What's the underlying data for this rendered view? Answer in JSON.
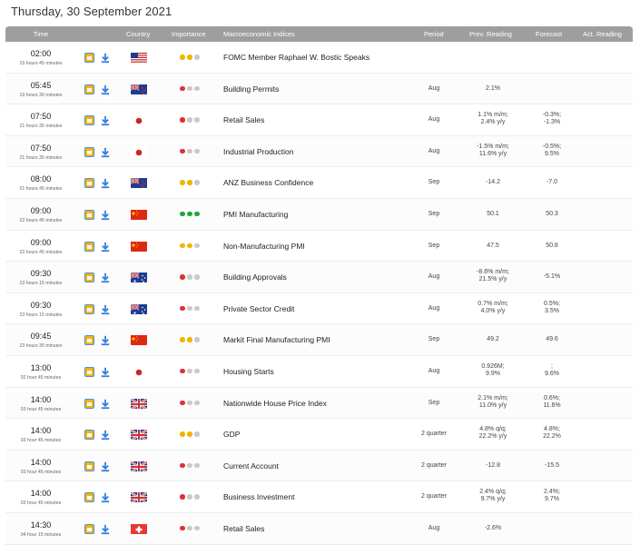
{
  "page": {
    "title": "Thursday, 30 September 2021"
  },
  "columns": {
    "time": "Time",
    "country": "Country",
    "importance": "Importance",
    "indices": "Macroeconomic Indices",
    "period": "Period",
    "prev": "Prev. Reading",
    "forecast": "Forecast",
    "actual": "Act. Reading"
  },
  "colors": {
    "header_bg": "#9e9e9e",
    "importance_high": "#22a53a",
    "importance_medium": "#f0b400",
    "importance_low": "#e03030",
    "importance_off": "#c9c9c9"
  },
  "rows": [
    {
      "time": "02:00",
      "sub": "15 hours 45 minutes",
      "flag": "us-flag",
      "importance": "medium",
      "indicator": "FOMC Member Raphael W. Bostic Speaks",
      "period": "",
      "prev": [
        "",
        ""
      ],
      "forecast": [
        "",
        ""
      ],
      "actual": ""
    },
    {
      "time": "05:45",
      "sub": "19 hours 30 minutes",
      "flag": "nz-flag",
      "importance": "low",
      "indicator": "Building Permits",
      "period": "Aug",
      "prev": [
        "2.1%",
        ""
      ],
      "forecast": [
        "",
        ""
      ],
      "actual": ""
    },
    {
      "time": "07:50",
      "sub": "21 hours 35 minutes",
      "flag": "jp-flag",
      "importance": "low",
      "indicator": "Retail Sales",
      "period": "Aug",
      "prev": [
        "1.1% m/m;",
        "2.4% y/y"
      ],
      "forecast": [
        "-0.3%;",
        "-1.3%"
      ],
      "actual": ""
    },
    {
      "time": "07:50",
      "sub": "21 hours 35 minutes",
      "flag": "jp-flag",
      "importance": "low",
      "indicator": "Industrial Production",
      "period": "Aug",
      "prev": [
        "-1.5% m/m;",
        "11.6% y/y"
      ],
      "forecast": [
        "-0.5%;",
        "9.5%"
      ],
      "actual": ""
    },
    {
      "time": "08:00",
      "sub": "21 hours 45 minutes",
      "flag": "nz-flag",
      "importance": "medium",
      "indicator": "ANZ Business Confidence",
      "period": "Sep",
      "prev": [
        "-14.2",
        ""
      ],
      "forecast": [
        "-7.0",
        ""
      ],
      "actual": ""
    },
    {
      "time": "09:00",
      "sub": "22 hours 45 minutes",
      "flag": "cn-flag",
      "importance": "high",
      "indicator": "PMI Manufacturing",
      "period": "Sep",
      "prev": [
        "50.1",
        ""
      ],
      "forecast": [
        "50.3",
        ""
      ],
      "actual": ""
    },
    {
      "time": "09:00",
      "sub": "22 hours 45 minutes",
      "flag": "cn-flag",
      "importance": "medium",
      "indicator": "Non-Manufacturing PMI",
      "period": "Sep",
      "prev": [
        "47.5",
        ""
      ],
      "forecast": [
        "50.8",
        ""
      ],
      "actual": ""
    },
    {
      "time": "09:30",
      "sub": "23 hours 15 minutes",
      "flag": "au-flag",
      "importance": "low",
      "indicator": "Building Approvals",
      "period": "Aug",
      "prev": [
        "-8.6% m/m;",
        "21.5% y/y"
      ],
      "forecast": [
        "-5.1%",
        ""
      ],
      "actual": ""
    },
    {
      "time": "09:30",
      "sub": "23 hours 15 minutes",
      "flag": "au-flag",
      "importance": "low",
      "indicator": "Private Sector Credit",
      "period": "Aug",
      "prev": [
        "0.7% m/m;",
        "4.0% y/y"
      ],
      "forecast": [
        "0.5%;",
        "3.5%"
      ],
      "actual": ""
    },
    {
      "time": "09:45",
      "sub": "23 hours 30 minutes",
      "flag": "cn-flag",
      "importance": "medium",
      "indicator": "Markit Final Manufacturing PMI",
      "period": "Sep",
      "prev": [
        "49.2",
        ""
      ],
      "forecast": [
        "49.6",
        ""
      ],
      "actual": ""
    },
    {
      "time": "13:00",
      "sub": "02 hour 45 minutes",
      "flag": "jp-flag",
      "importance": "low",
      "indicator": "Housing Starts",
      "period": "Aug",
      "prev": [
        "0.926M;",
        "9.9%"
      ],
      "forecast": [
        ";",
        "9.6%"
      ],
      "actual": ""
    },
    {
      "time": "14:00",
      "sub": "03 hour 45 minutes",
      "flag": "uk-flag",
      "importance": "low",
      "indicator": "Nationwide House Price Index",
      "period": "Sep",
      "prev": [
        "2.1% m/m;",
        "11.0% y/y"
      ],
      "forecast": [
        "0.6%;",
        "11.6%"
      ],
      "actual": ""
    },
    {
      "time": "14:00",
      "sub": "03 hour 45 minutes",
      "flag": "uk-flag",
      "importance": "medium",
      "indicator": "GDP",
      "period": "2 quarter",
      "prev": [
        "4.8% q/q;",
        "22.2% y/y"
      ],
      "forecast": [
        "4.8%;",
        "22.2%"
      ],
      "actual": ""
    },
    {
      "time": "14:00",
      "sub": "03 hour 45 minutes",
      "flag": "uk-flag",
      "importance": "low",
      "indicator": "Current Account",
      "period": "2 quarter",
      "prev": [
        "-12.8",
        ""
      ],
      "forecast": [
        "-15.5",
        ""
      ],
      "actual": ""
    },
    {
      "time": "14:00",
      "sub": "03 hour 45 minutes",
      "flag": "uk-flag",
      "importance": "low",
      "indicator": "Business Investment",
      "period": "2 quarter",
      "prev": [
        "2.4% q/q;",
        "9.7% y/y"
      ],
      "forecast": [
        "2.4%;",
        "9.7%"
      ],
      "actual": ""
    },
    {
      "time": "14:30",
      "sub": "04 hour 15 minutes",
      "flag": "ch-flag",
      "importance": "low",
      "indicator": "Retail Sales",
      "period": "Aug",
      "prev": [
        "-2.6%",
        ""
      ],
      "forecast": [
        "",
        ""
      ],
      "actual": ""
    }
  ]
}
